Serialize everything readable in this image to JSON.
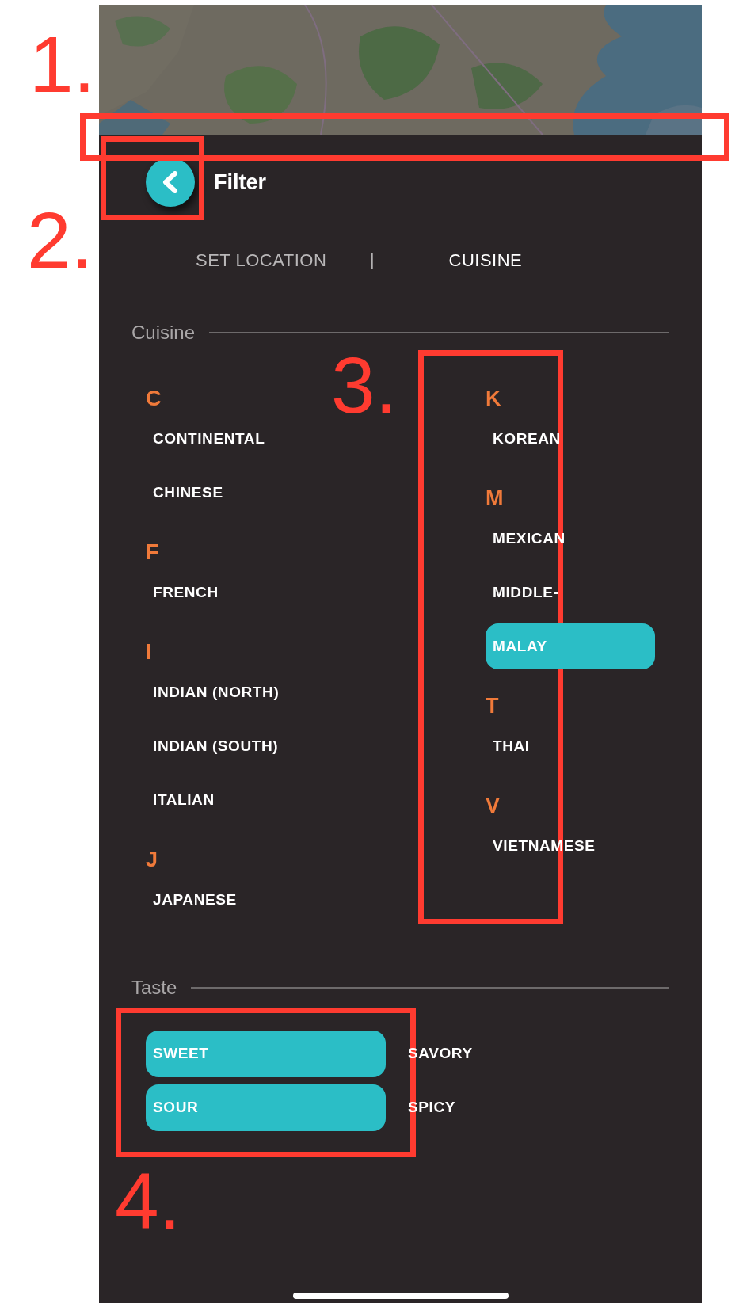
{
  "annotations": [
    {
      "label": "1."
    },
    {
      "label": "2."
    },
    {
      "label": "3."
    },
    {
      "label": "4."
    }
  ],
  "header": {
    "title": "Filter"
  },
  "tabs": [
    {
      "label": "SET LOCATION",
      "selected": false
    },
    {
      "label": "CUISINE",
      "selected": true
    }
  ],
  "tab_separator": "|",
  "cuisine": {
    "heading": "Cuisine",
    "columns": [
      [
        {
          "letter": "C",
          "items": [
            {
              "label": "CONTINENTAL",
              "selected": false
            },
            {
              "label": "CHINESE",
              "selected": false
            }
          ]
        },
        {
          "letter": "F",
          "items": [
            {
              "label": "FRENCH",
              "selected": false
            }
          ]
        },
        {
          "letter": "I",
          "items": [
            {
              "label": "INDIAN (NORTH)",
              "selected": false
            },
            {
              "label": "INDIAN (SOUTH)",
              "selected": false
            },
            {
              "label": "ITALIAN",
              "selected": false
            }
          ]
        },
        {
          "letter": "J",
          "items": [
            {
              "label": "JAPANESE",
              "selected": false
            }
          ]
        }
      ],
      [
        {
          "letter": "K",
          "items": [
            {
              "label": "KOREAN",
              "selected": false
            }
          ]
        },
        {
          "letter": "M",
          "items": [
            {
              "label": "MEXICAN",
              "selected": false
            },
            {
              "label": "MIDDLE-",
              "selected": false
            },
            {
              "label": "MALAY",
              "selected": true
            }
          ]
        },
        {
          "letter": "T",
          "items": [
            {
              "label": "THAI",
              "selected": false
            }
          ]
        },
        {
          "letter": "V",
          "items": [
            {
              "label": "VIETNAMESE",
              "selected": false
            }
          ]
        }
      ]
    ]
  },
  "taste": {
    "heading": "Taste",
    "options": [
      {
        "label": "SWEET",
        "selected": true
      },
      {
        "label": "SAVORY",
        "selected": false
      },
      {
        "label": "SOUR",
        "selected": true
      },
      {
        "label": "SPICY",
        "selected": false
      }
    ]
  }
}
